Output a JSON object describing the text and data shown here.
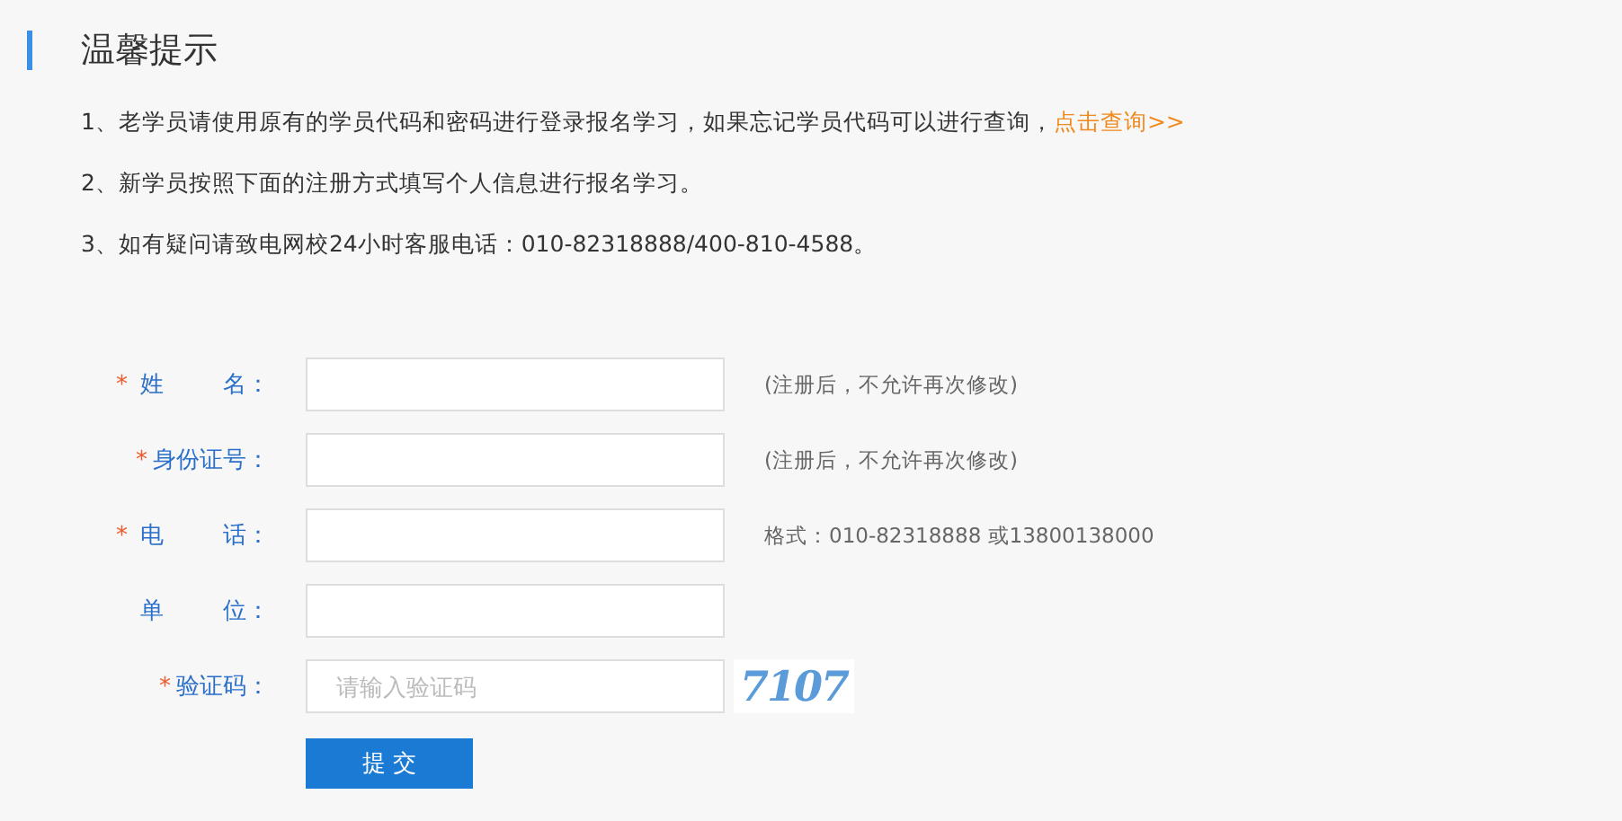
{
  "notice": {
    "title": "温馨提示",
    "items": [
      {
        "text": "1、老学员请使用原有的学员代码和密码进行登录报名学习，如果忘记学员代码可以进行查询，",
        "link": "点击查询>>"
      },
      {
        "text": "2、新学员按照下面的注册方式填写个人信息进行报名学习。"
      },
      {
        "text": "3、如有疑问请致电网校24小时客服电话：010-82318888/400-810-4588。"
      }
    ]
  },
  "form": {
    "fields": [
      {
        "mark": "*",
        "label": [
          "姓",
          "名："
        ],
        "hint": "(注册后，不允许再次修改)"
      },
      {
        "mark": "*",
        "label": [
          "身份证号："
        ],
        "hint": "(注册后，不允许再次修改)"
      },
      {
        "mark": "*",
        "label": [
          "电",
          "话："
        ],
        "hint": "格式：010-82318888 或13800138000"
      },
      {
        "label": [
          "单",
          "位："
        ]
      },
      {
        "mark": "*",
        "label": [
          "验证码："
        ],
        "placeholder": "请输入验证码",
        "captcha": "7107"
      }
    ],
    "submit": "提 交"
  }
}
